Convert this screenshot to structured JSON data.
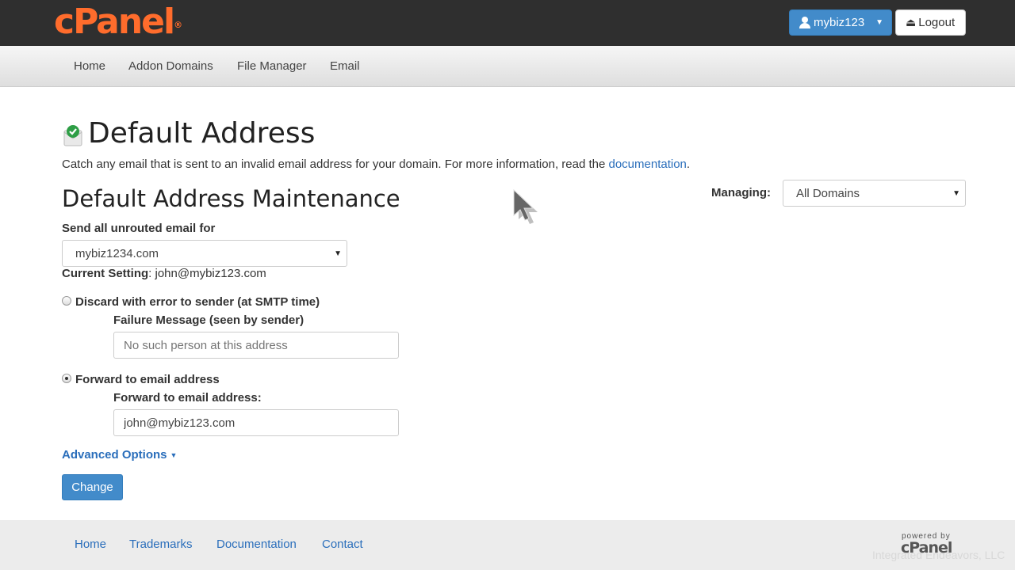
{
  "app": {
    "logo": "cPanel",
    "logo_mark": "®"
  },
  "user_menu": {
    "username": "mybiz123",
    "logout": "Logout"
  },
  "nav": [
    {
      "label": "Home"
    },
    {
      "label": "Addon Domains"
    },
    {
      "label": "File Manager"
    },
    {
      "label": "Email"
    }
  ],
  "page": {
    "title": "Default Address",
    "description": "Catch any email that is sent to an invalid email address for your domain. For more information, read the ",
    "doc_link": "documentation",
    "desc_end": "."
  },
  "maintenance": {
    "title": "Default Address Maintenance",
    "managing_label": "Managing:",
    "managing_value": "All Domains",
    "send_label": "Send all unrouted email for",
    "domain_value": "mybiz1234.com",
    "current_label": "Current Setting",
    "current_value": ": john@mybiz123.com",
    "discard_label": "Discard with error to sender (at SMTP time)",
    "failure_label": "Failure Message (seen by sender)",
    "failure_placeholder": "No such person at this address",
    "forward_label": "Forward to email address",
    "forward_field_label": "Forward to email address:",
    "forward_value": "john@mybiz123.com",
    "advanced": "Advanced Options",
    "change_button": "Change",
    "selected_option": "forward"
  },
  "footer": {
    "links": [
      {
        "label": "Home"
      },
      {
        "label": "Trademarks"
      },
      {
        "label": "Documentation"
      },
      {
        "label": "Contact"
      }
    ],
    "powered_by": "powered by",
    "powered_logo": "cPanel",
    "watermark": "Integrated Endeavors, LLC"
  },
  "colors": {
    "brand": "#ff6c2c",
    "primary": "#428bca",
    "link": "#2a6ebb"
  }
}
